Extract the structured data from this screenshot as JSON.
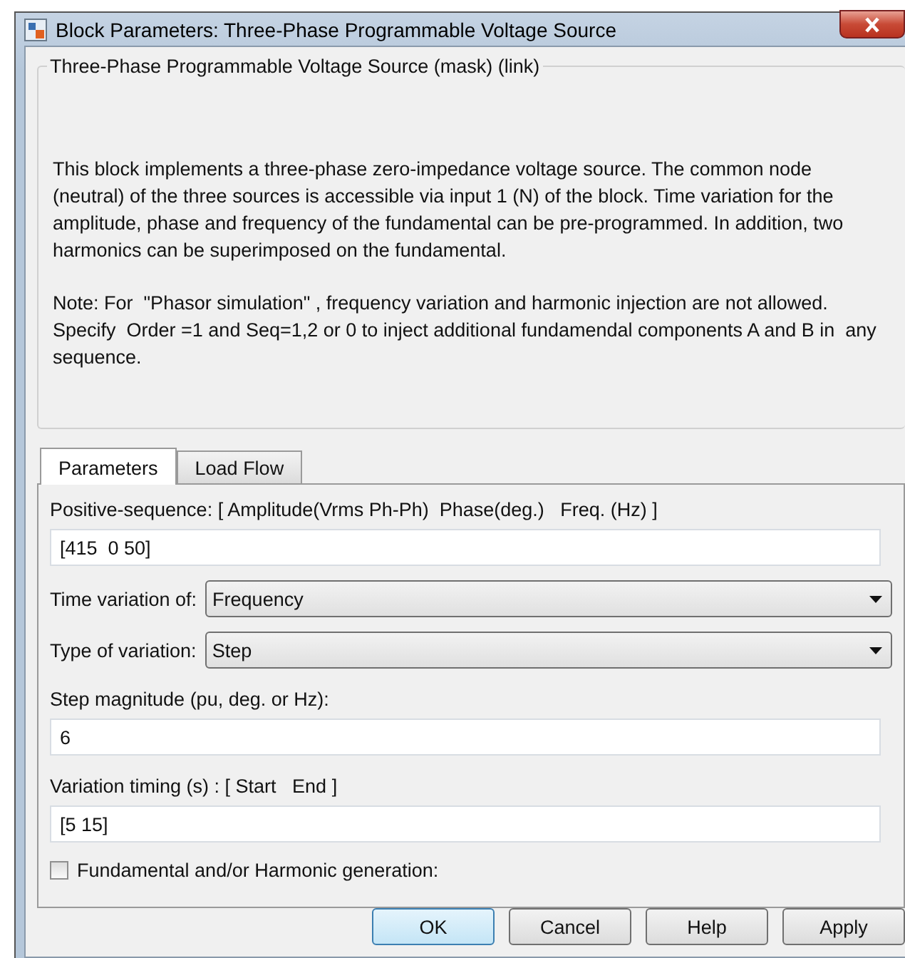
{
  "window": {
    "title": "Block Parameters: Three-Phase Programmable Voltage Source"
  },
  "group": {
    "title": "Three-Phase Programmable Voltage Source (mask) (link)",
    "paragraphs": [
      "This block implements a three-phase zero-impedance voltage source. The common node (neutral) of the three sources is accessible via input 1 (N) of the block. Time variation for the amplitude, phase and frequency of the fundamental can be pre-programmed. In addition, two harmonics can be superimposed on the fundamental.",
      "Note: For  \"Phasor simulation\" , frequency variation and harmonic injection are not allowed.  Specify  Order =1 and Seq=1,2 or 0 to inject additional fundamendal components A and B in  any sequence."
    ]
  },
  "tabs": [
    {
      "label": "Parameters",
      "selected": true
    },
    {
      "label": "Load Flow",
      "selected": false
    }
  ],
  "parameters": [
    {
      "kind": "text",
      "label": "Positive-sequence: [ Amplitude(Vrms Ph-Ph)  Phase(deg.)   Freq. (Hz) ]",
      "value": "[415  0 50]"
    },
    {
      "kind": "dropdown",
      "label": "Time variation of:",
      "value": "Frequency"
    },
    {
      "kind": "dropdown",
      "label": "Type of variation:",
      "value": "Step"
    },
    {
      "kind": "text",
      "label": "Step magnitude (pu, deg. or Hz):",
      "value": "6"
    },
    {
      "kind": "text",
      "label": "Variation timing (s) : [ Start   End ]",
      "value": "[5 15]"
    },
    {
      "kind": "checkbox",
      "label": "Fundamental and/or Harmonic generation:",
      "checked": false
    }
  ],
  "buttons": [
    {
      "label": "OK",
      "default": true
    },
    {
      "label": "Cancel",
      "default": false
    },
    {
      "label": "Help",
      "default": false
    },
    {
      "label": "Apply",
      "default": false
    }
  ]
}
